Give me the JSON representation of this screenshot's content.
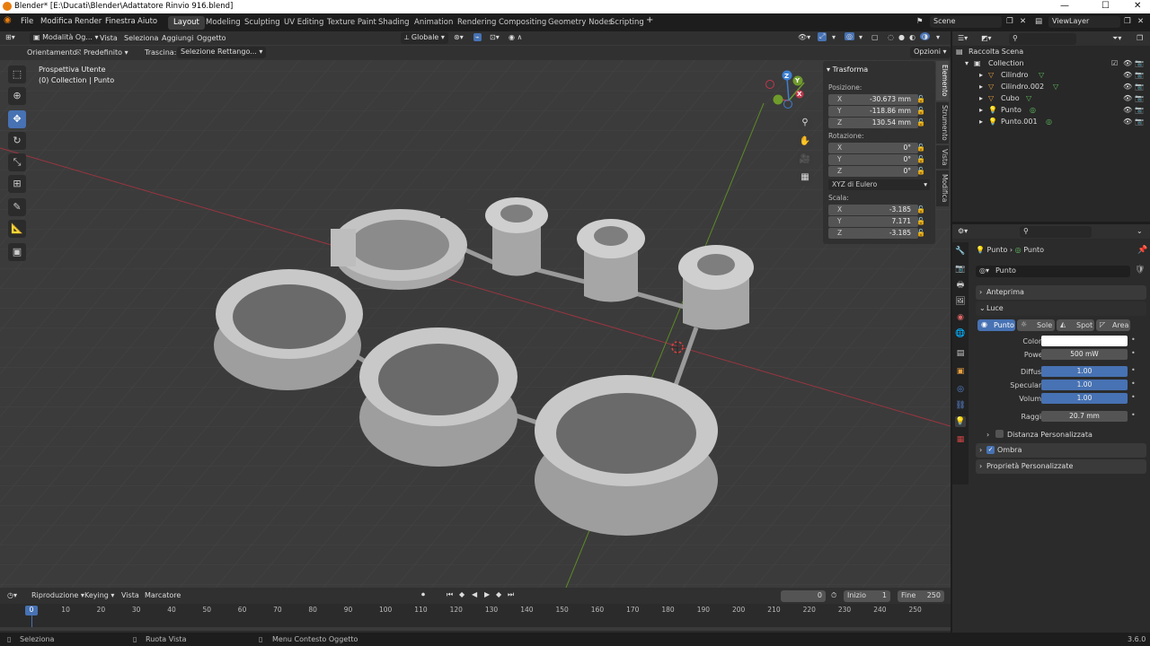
{
  "window": {
    "title": "Blender* [E:\\Ducati\\Blender\\Adattatore Rinvio 916.blend]",
    "minimize": "—",
    "maximize": "☐",
    "close": "✕"
  },
  "menubar": {
    "menus": [
      "File",
      "Modifica",
      "Render",
      "Finestra",
      "Aiuto"
    ],
    "workspaces": [
      "Layout",
      "Modeling",
      "Sculpting",
      "UV Editing",
      "Texture Paint",
      "Shading",
      "Animation",
      "Rendering",
      "Compositing",
      "Geometry Nodes",
      "Scripting"
    ],
    "active_workspace": "Layout",
    "add_workspace": "+",
    "scene": "Scene",
    "view_layer": "ViewLayer"
  },
  "viewport_header": {
    "mode": "Modalità Og...",
    "menus": [
      "Vista",
      "Seleziona",
      "Aggiungi",
      "Oggetto"
    ],
    "transform_orientation": "Globale"
  },
  "tool_header": {
    "orientation_label": "Orientamento:",
    "orientation_value": "Predefinito",
    "drag_label": "Trascina:",
    "drag_value": "Selezione Rettango...",
    "options": "Opzioni"
  },
  "viewport": {
    "view_name": "Prospettiva Utente",
    "context": "(0) Collection | Punto",
    "gizmo": {
      "x": "X",
      "y": "Y",
      "z": "Z"
    }
  },
  "npanel": {
    "header": "Trasforma",
    "location_label": "Posizione:",
    "location": [
      {
        "axis": "X",
        "value": "-30.673 mm"
      },
      {
        "axis": "Y",
        "value": "-118.86 mm"
      },
      {
        "axis": "Z",
        "value": "130.54 mm"
      }
    ],
    "rotation_label": "Rotazione:",
    "rotation": [
      {
        "axis": "X",
        "value": "0°"
      },
      {
        "axis": "Y",
        "value": "0°"
      },
      {
        "axis": "Z",
        "value": "0°"
      }
    ],
    "rotation_mode": "XYZ di Eulero",
    "scale_label": "Scala:",
    "scale": [
      {
        "axis": "X",
        "value": "-3.185"
      },
      {
        "axis": "Y",
        "value": "7.171"
      },
      {
        "axis": "Z",
        "value": "-3.185"
      }
    ],
    "tabs": [
      "Elemento",
      "Strumento",
      "Vista",
      "Modifica"
    ]
  },
  "timeline": {
    "menus": [
      "Riproduzione",
      "Keying",
      "Vista",
      "Marcatore"
    ],
    "current_frame": "0",
    "start_label": "Inizio",
    "start": "1",
    "end_label": "Fine",
    "end": "250",
    "playhead": "0",
    "ticks": [
      "10",
      "20",
      "30",
      "40",
      "50",
      "60",
      "70",
      "80",
      "90",
      "100",
      "110",
      "120",
      "130",
      "140",
      "150",
      "160",
      "170",
      "180",
      "190",
      "200",
      "210",
      "220",
      "230",
      "240",
      "250"
    ]
  },
  "statusbar": {
    "items": [
      "Seleziona",
      "Ruota Vista",
      "Menu Contesto Oggetto"
    ],
    "version": "3.6.0"
  },
  "outliner": {
    "root": "Raccolta Scena",
    "collection": "Collection",
    "items": [
      "Cilindro",
      "Cilindro.002",
      "Cubo",
      "Punto",
      "Punto.001"
    ]
  },
  "properties": {
    "breadcrumb_object": "Punto",
    "breadcrumb_data": "Punto",
    "datablock_name": "Punto",
    "sections": {
      "preview": "Anteprima",
      "light": "Luce",
      "custom_distance": "Distanza Personalizzata",
      "shadow": "Ombra",
      "custom_props": "Proprietà Personalizzate"
    },
    "light_types": [
      "Punto",
      "Sole",
      "Spot",
      "Area"
    ],
    "active_light_type": "Punto",
    "fields": {
      "color_label": "Colore",
      "color": "#ffffff",
      "power_label": "Power",
      "power": "500 mW",
      "diffuse_label": "Diffuso",
      "diffuse": "1.00",
      "specular_label": "Speculare",
      "specular": "1.00",
      "volume_label": "Volume",
      "volume": "1.00",
      "radius_label": "Raggio",
      "radius": "20.7 mm"
    },
    "shadow_checked": true
  },
  "colors": {
    "accent": "#4772b3",
    "x_axis": "#c3384c",
    "y_axis": "#6f9b2c",
    "z_axis": "#3d7fd1",
    "orange": "#e87d0d"
  }
}
